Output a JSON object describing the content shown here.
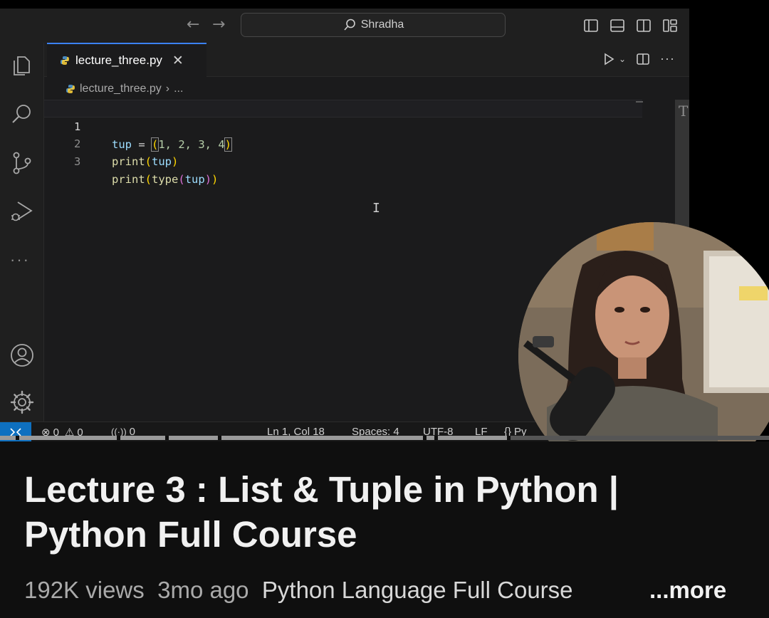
{
  "vscode": {
    "search_label": "Shradha",
    "tab_filename": "lecture_three.py",
    "breadcrumb_file": "lecture_three.py",
    "breadcrumb_sep": "›",
    "breadcrumb_more": "...",
    "code_lines": [
      {
        "num": "1",
        "a": "tup",
        "b": " = ",
        "c": "(",
        "d": "1, 2, 3, 4",
        "e": ")"
      },
      {
        "num": "2",
        "fn": "print",
        "c": "(",
        "arg": "tup",
        "e": ")"
      },
      {
        "num": "3",
        "fn": "print",
        "c": "(",
        "fn2": "type",
        "c2": "(",
        "arg": "tup",
        "e2": ")",
        "e": ")"
      }
    ],
    "status": {
      "errors": "0",
      "warnings": "0",
      "ports": "0",
      "position": "Ln 1, Col 18",
      "spaces": "Spaces: 4",
      "encoding": "UTF-8",
      "eol": "LF",
      "language": "Py"
    }
  },
  "video": {
    "title": "Lecture 3 : List & Tuple in Python | Python Full Course",
    "views": "192K views",
    "age": "3mo ago",
    "playlist": "Python Language Full Course",
    "more_label": "...more"
  },
  "colors": {
    "accent_blue": "#0e70c0",
    "tab_border": "#3b82f6",
    "background": "#0f0f0f"
  }
}
